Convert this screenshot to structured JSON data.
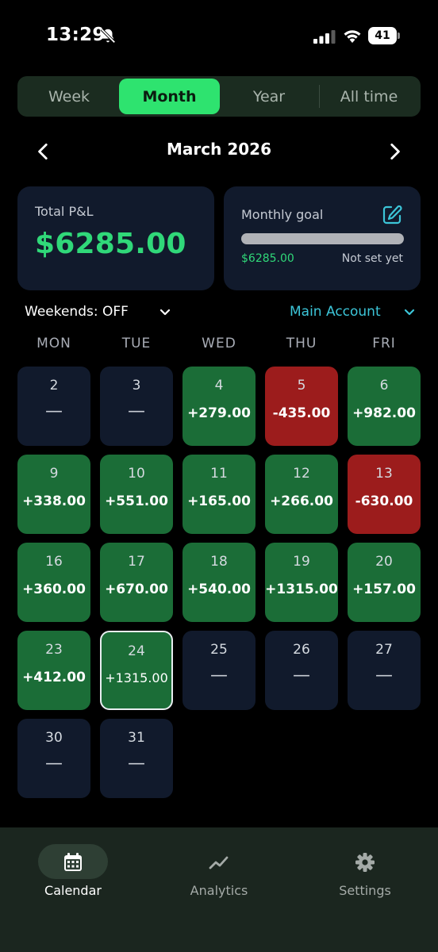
{
  "status": {
    "time": "13:29",
    "battery": "41"
  },
  "segmented": {
    "options": [
      {
        "label": "Week",
        "active": false
      },
      {
        "label": "Month",
        "active": true
      },
      {
        "label": "Year",
        "active": false
      },
      {
        "label": "All time",
        "active": false
      }
    ]
  },
  "month_nav": {
    "title": "March 2026",
    "prev_icon": "chevron-left-icon",
    "next_icon": "chevron-right-icon"
  },
  "summary": {
    "total_pnl": {
      "label": "Total P&L",
      "value": "$6285.00"
    },
    "monthly_goal": {
      "label": "Monthly goal",
      "current": "$6285.00",
      "target": "Not set yet",
      "edit_icon": "edit-icon"
    }
  },
  "filters": {
    "weekends": "Weekends: OFF",
    "account": "Main Account"
  },
  "calendar": {
    "weekdays": [
      "MON",
      "TUE",
      "WED",
      "THU",
      "FRI"
    ],
    "days": [
      {
        "day": "2",
        "value": "—",
        "status": "neutral"
      },
      {
        "day": "3",
        "value": "—",
        "status": "neutral"
      },
      {
        "day": "4",
        "value": "+279.00",
        "status": "profit"
      },
      {
        "day": "5",
        "value": "-435.00",
        "status": "loss"
      },
      {
        "day": "6",
        "value": "+982.00",
        "status": "profit"
      },
      {
        "day": "9",
        "value": "+338.00",
        "status": "profit"
      },
      {
        "day": "10",
        "value": "+551.00",
        "status": "profit"
      },
      {
        "day": "11",
        "value": "+165.00",
        "status": "profit"
      },
      {
        "day": "12",
        "value": "+266.00",
        "status": "profit"
      },
      {
        "day": "13",
        "value": "-630.00",
        "status": "loss"
      },
      {
        "day": "16",
        "value": "+360.00",
        "status": "profit"
      },
      {
        "day": "17",
        "value": "+670.00",
        "status": "profit"
      },
      {
        "day": "18",
        "value": "+540.00",
        "status": "profit"
      },
      {
        "day": "19",
        "value": "+1315.00",
        "status": "profit"
      },
      {
        "day": "20",
        "value": "+157.00",
        "status": "profit"
      },
      {
        "day": "23",
        "value": "+412.00",
        "status": "profit"
      },
      {
        "day": "24",
        "value": "+1315.00",
        "status": "profit",
        "today": true
      },
      {
        "day": "25",
        "value": "—",
        "status": "neutral"
      },
      {
        "day": "26",
        "value": "—",
        "status": "neutral"
      },
      {
        "day": "27",
        "value": "—",
        "status": "neutral"
      },
      {
        "day": "30",
        "value": "—",
        "status": "neutral"
      },
      {
        "day": "31",
        "value": "—",
        "status": "neutral"
      }
    ]
  },
  "bottom_nav": {
    "items": [
      {
        "label": "Calendar",
        "icon": "calendar-icon",
        "active": true
      },
      {
        "label": "Analytics",
        "icon": "analytics-icon",
        "active": false
      },
      {
        "label": "Settings",
        "icon": "gear-icon",
        "active": false
      }
    ]
  },
  "colors": {
    "accent": "#2ee36f",
    "profit_text": "#30d879",
    "profit_cell": "#1b6d37",
    "loss_cell": "#9c1c1c",
    "neutral_cell": "#111a2c",
    "account_link": "#3cc5d8"
  }
}
